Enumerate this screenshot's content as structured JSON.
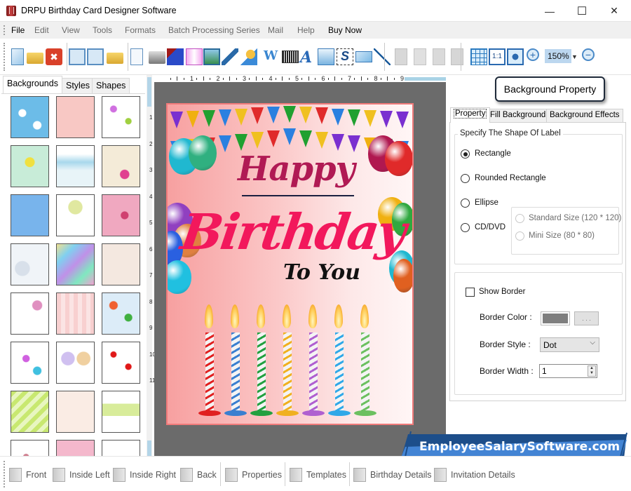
{
  "window": {
    "title": "DRPU Birthday Card Designer Software",
    "minimize_glyph": "—",
    "maximize_glyph": "☐",
    "close_glyph": "✕"
  },
  "menu": [
    "File",
    "Edit",
    "View",
    "Tools",
    "Formats",
    "Batch Processing Series",
    "Mail",
    "Help",
    "Buy Now"
  ],
  "toolbar": {
    "groups": [
      [
        "new-file-icon",
        "open-file-icon",
        "close-file-icon"
      ],
      [
        "save-icon",
        "save-as-icon",
        "export-icon"
      ],
      [
        "properties-icon",
        "print-icon",
        "layers-icon",
        "gift-icon",
        "insert-image-icon",
        "signature-pen-icon",
        "shape-picker-icon",
        "word-art-icon",
        "barcode-icon",
        "text-icon",
        "text-box-icon",
        "selection-icon",
        "email-icon",
        "line-icon"
      ],
      [
        "cut-icon",
        "copy-icon",
        "paste-icon",
        "delete-icon"
      ],
      [
        "grid-icon",
        "actual-size-icon",
        "fit-to-window-icon",
        "zoom-in-icon",
        "zoom-out-icon"
      ]
    ],
    "zoom_value": "150%"
  },
  "left_panel": {
    "tabs": [
      "Backgrounds",
      "Styles",
      "Shapes"
    ],
    "selected_tab": "Backgrounds",
    "thumbnails": [
      "sky-clouds",
      "pink-pattern",
      "butterflies",
      "daisies",
      "pastel-landscape",
      "bird-balloons",
      "blue-stars",
      "pastel-balloons",
      "pink-birthday",
      "bubbles",
      "rainbow-pastel",
      "teddy-bear",
      "happy-birthday-text",
      "pink-hearts-stripes",
      "balloons-sky",
      "colorful-hearts",
      "balloon-bouquets",
      "red-hearts",
      "green-stripes",
      "cake-pattern",
      "flowers-garden",
      "pink-roses",
      "pink-lace",
      "sketch-flower"
    ]
  },
  "rulers": {
    "horizontal": [
      "1",
      "2",
      "3",
      "4",
      "5",
      "6",
      "7",
      "8",
      "9"
    ],
    "vertical": [
      "1",
      "2",
      "3",
      "4",
      "5",
      "6",
      "7",
      "8",
      "9",
      "10",
      "11"
    ]
  },
  "card": {
    "line1": "Happy",
    "line2": "Birthday",
    "line3": "To You",
    "candle_colors": [
      "#e02020",
      "#3a7fd0",
      "#22a040",
      "#f0b020",
      "#b060d0",
      "#30a8e8",
      "#6cc060"
    ]
  },
  "right_panel": {
    "title": "Background Property",
    "tabs": [
      "Property",
      "Fill Background",
      "Background Effects"
    ],
    "selected_tab": "Property",
    "shape_group_label": "Specify The Shape Of Label",
    "shapes": [
      {
        "label": "Rectangle",
        "selected": true
      },
      {
        "label": "Rounded Rectangle",
        "selected": false
      },
      {
        "label": "Ellipse",
        "selected": false
      },
      {
        "label": "CD/DVD",
        "selected": false
      }
    ],
    "cd_sizes": [
      {
        "label": "Standard Size (120 * 120)",
        "enabled": false
      },
      {
        "label": "Mini Size (80 * 80)",
        "enabled": false
      }
    ],
    "show_border_label": "Show Border",
    "show_border_checked": false,
    "border_color_label": "Border Color :",
    "border_color": "#7f7f7f",
    "border_color_button": ". . .",
    "border_style_label": "Border Style :",
    "border_style_value": "Dot",
    "border_width_label": "Border Width :",
    "border_width_value": "1"
  },
  "watermark": "EmployeeSalarySoftware.com",
  "bottom_bar": {
    "items": [
      "Front",
      "Inside Left",
      "Inside Right",
      "Back",
      "Properties",
      "Templates",
      "Birthday Details",
      "Invitation Details"
    ]
  }
}
